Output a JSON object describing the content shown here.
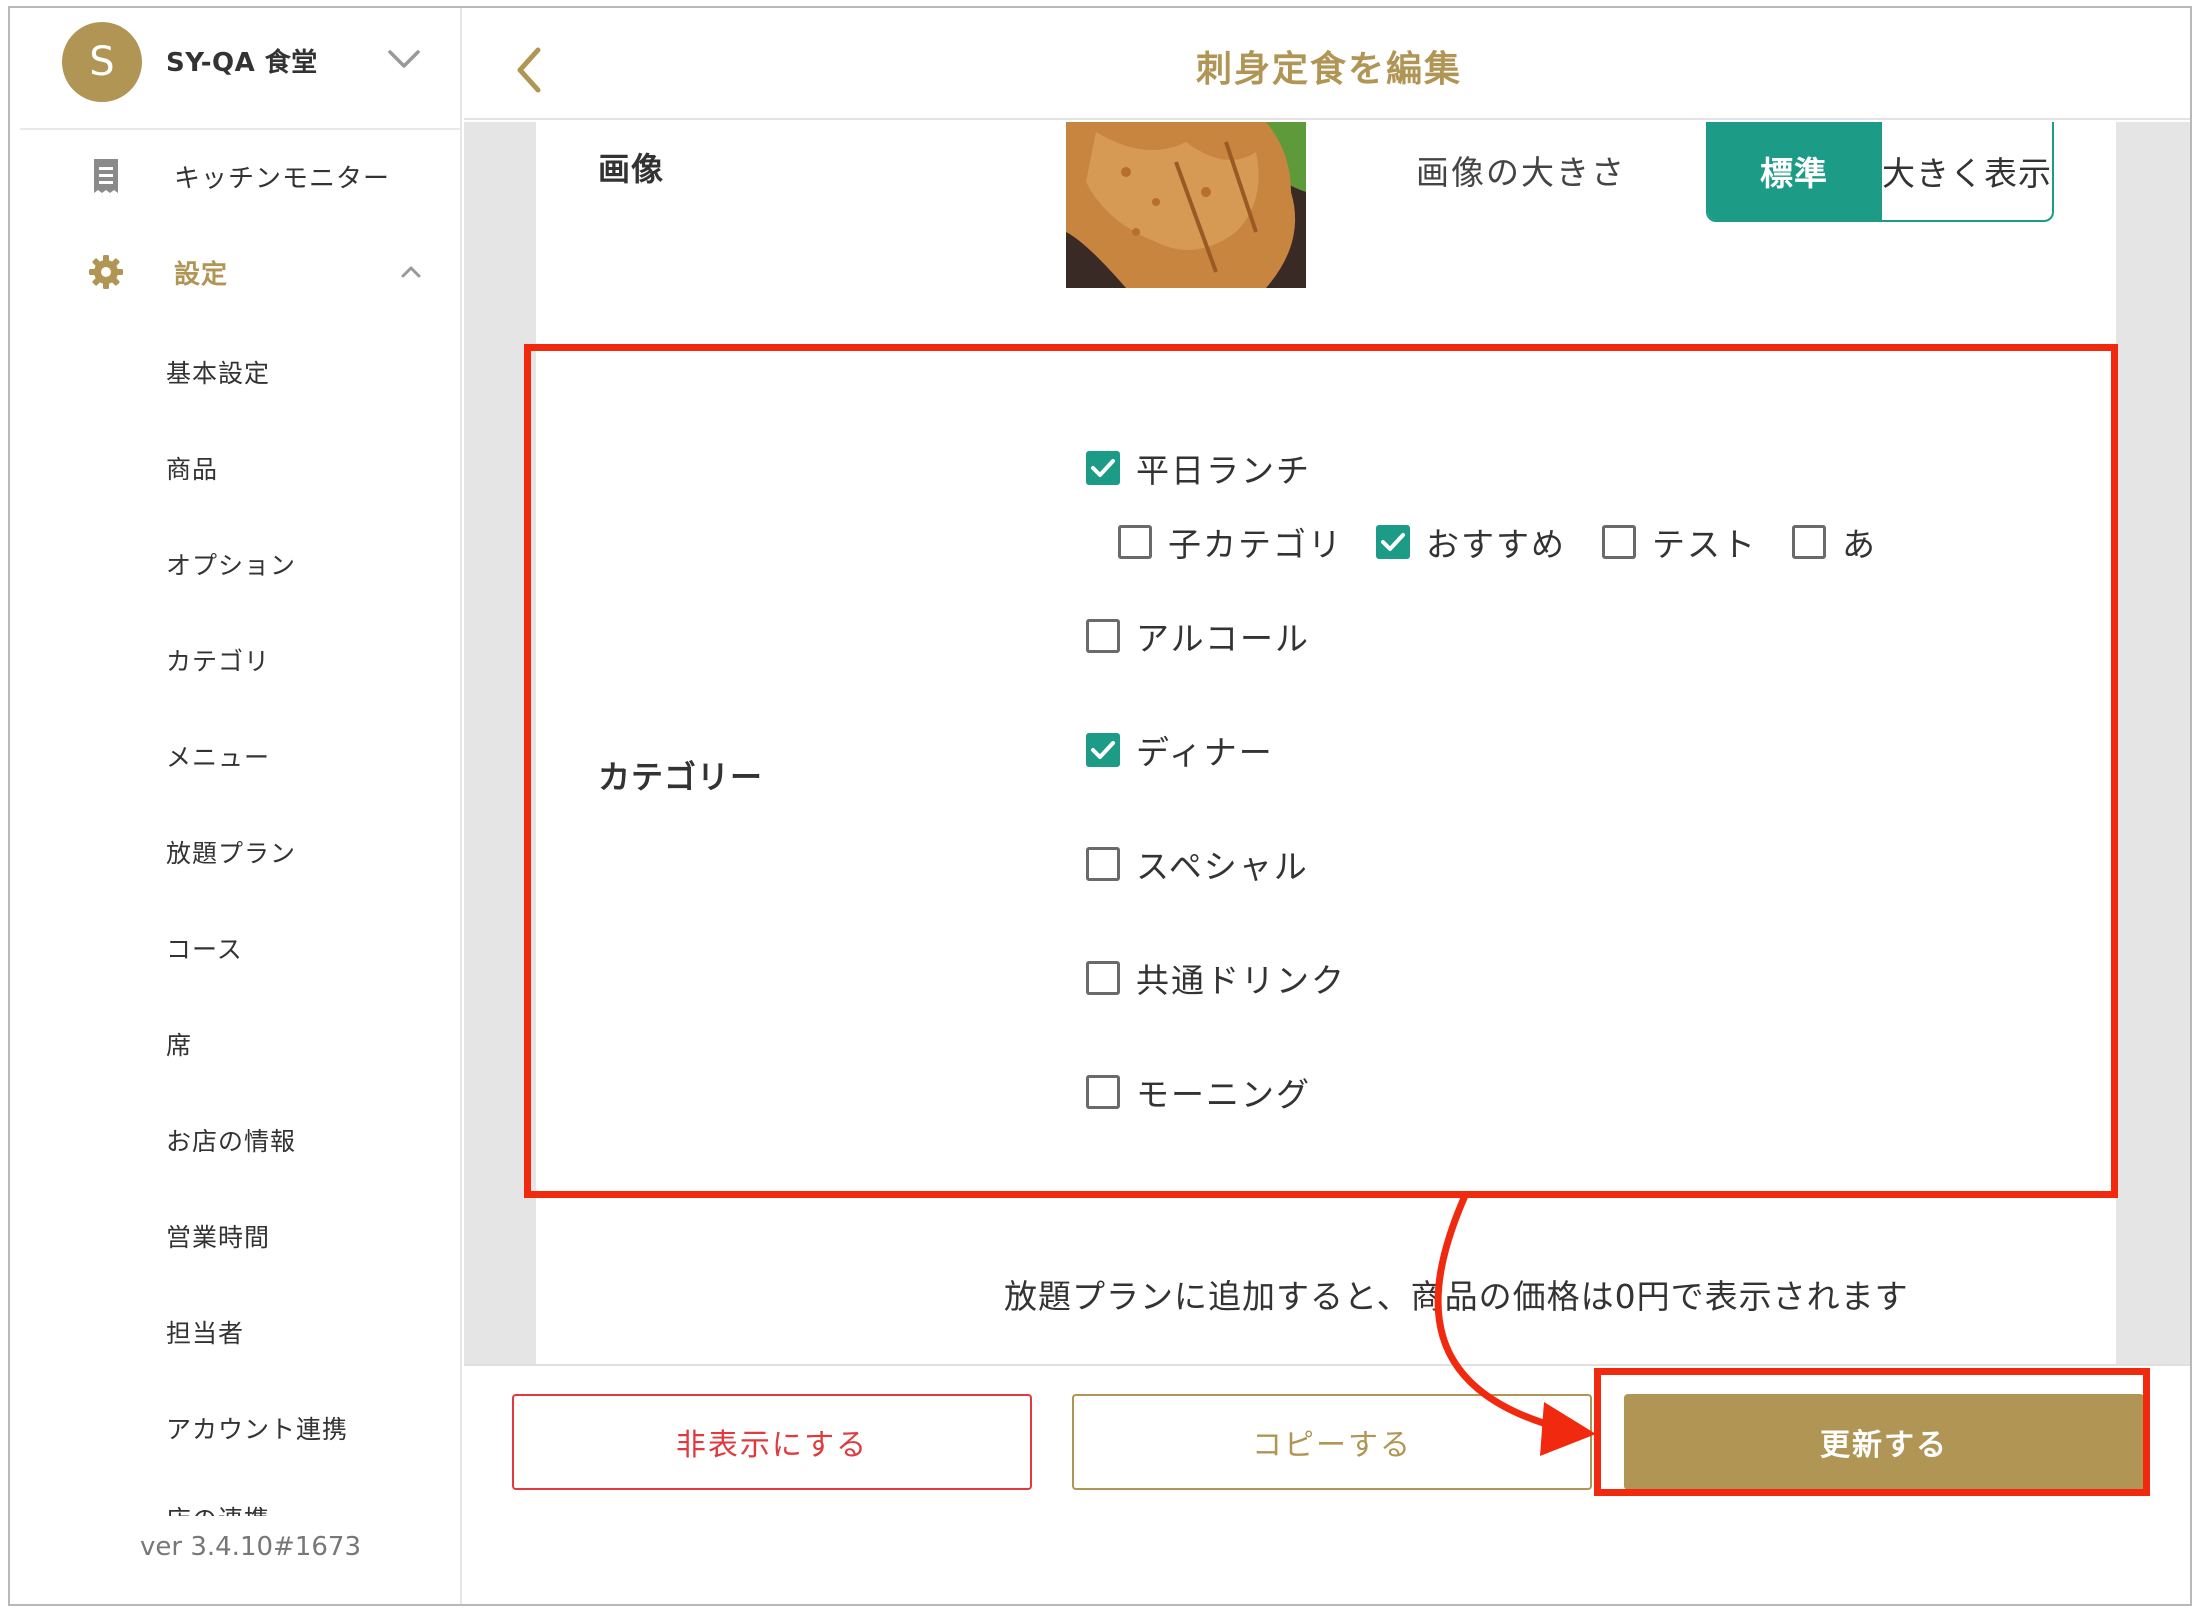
{
  "store": {
    "avatar_letter": "S",
    "name": "SY-QA 食堂"
  },
  "sidebar": {
    "kitchen_monitor": "キッチンモニター",
    "settings": "設定",
    "sub_items": [
      "基本設定",
      "商品",
      "オプション",
      "カテゴリ",
      "メニュー",
      "放題プラン",
      "コース",
      "席",
      "お店の情報",
      "営業時間",
      "担当者",
      "アカウント連携"
    ],
    "cut_item": "店の連携",
    "version": "ver 3.4.10#1673"
  },
  "header": {
    "title": "刺身定食を編集"
  },
  "image_section": {
    "label": "画像",
    "size_label": "画像の大きさ",
    "size_options": [
      "標準",
      "大きく表示"
    ],
    "selected": "標準"
  },
  "category_section": {
    "label": "カテゴリー",
    "items": [
      {
        "label": "平日ランチ",
        "checked": true
      },
      {
        "label": "子カテゴリ",
        "checked": false
      },
      {
        "label": "おすすめ",
        "checked": true
      },
      {
        "label": "テスト",
        "checked": false
      },
      {
        "label": "あ",
        "checked": false
      },
      {
        "label": "アルコール",
        "checked": false
      },
      {
        "label": "ディナー",
        "checked": true
      },
      {
        "label": "スペシャル",
        "checked": false
      },
      {
        "label": "共通ドリンク",
        "checked": false
      },
      {
        "label": "モーニング",
        "checked": false
      }
    ]
  },
  "note": "放題プランに追加すると、商品の価格は0円で表示されます",
  "footer": {
    "hide_label": "非表示にする",
    "copy_label": "コピーする",
    "update_label": "更新する"
  },
  "colors": {
    "brand_gold": "#b09555",
    "teal": "#1c9b86",
    "danger": "#e0393e",
    "annotation_red": "#f0290f"
  }
}
